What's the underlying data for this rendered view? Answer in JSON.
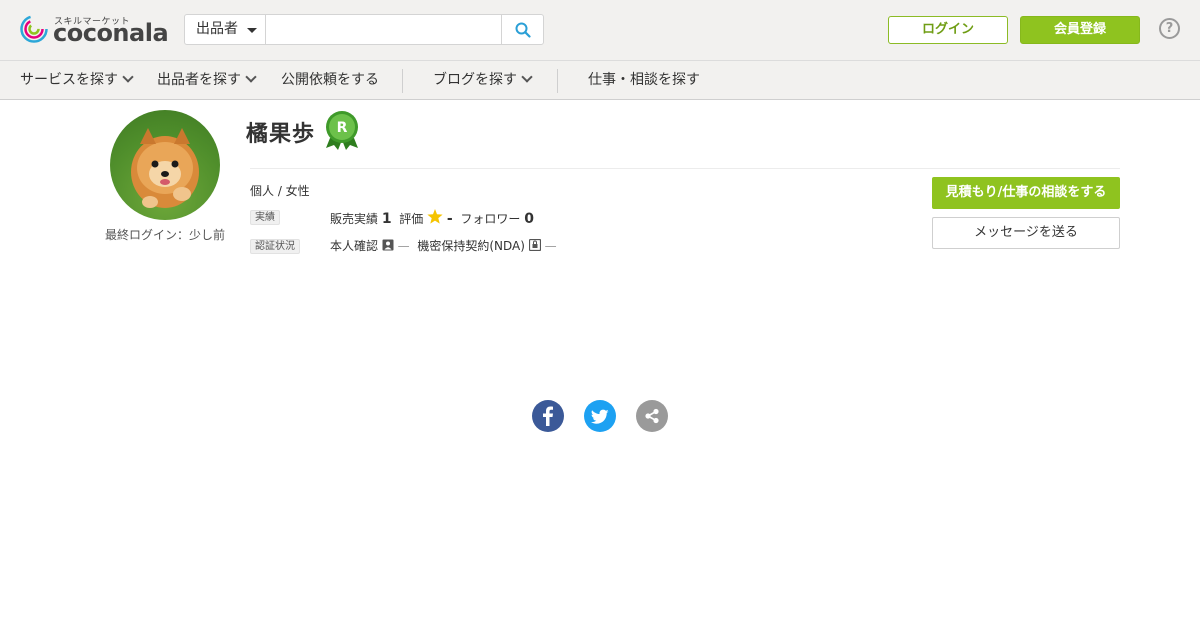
{
  "brand": {
    "sub": "スキルマーケット",
    "name": "coconala"
  },
  "search": {
    "category": "出品者",
    "placeholder": ""
  },
  "header": {
    "login": "ログイン",
    "register": "会員登録",
    "help": "?"
  },
  "nav": {
    "items": [
      {
        "label": "サービスを探す"
      },
      {
        "label": "出品者を探す"
      },
      {
        "label": "公開依頼をする"
      },
      {
        "label": "ブログを探す"
      },
      {
        "label": "仕事・相談を探す"
      }
    ]
  },
  "profile": {
    "name": "橘果歩",
    "rank": "R",
    "last_login": "最終ログイン：少し前",
    "type": "個人 / 女性",
    "performance_tag": "実績",
    "sales_label": "販売実績",
    "sales_value": "1",
    "rating_label": "評価",
    "rating_value": "-",
    "follower_label": "フォロワー",
    "follower_value": "0",
    "verification_tag": "認証状況",
    "identity_label": "本人確認",
    "identity_value": "—",
    "nda_label": "機密保持契約(NDA)",
    "nda_value": "—"
  },
  "actions": {
    "consult": "見積もり/仕事の相談をする",
    "message": "メッセージを送る"
  },
  "colors": {
    "accent": "#8fc31f",
    "header_bg": "#f2f1ef",
    "facebook": "#3b5998",
    "twitter": "#1da1f2",
    "share": "#9a9a9a",
    "star": "#f5c400"
  },
  "icons": [
    "search-icon",
    "chevron-down-icon",
    "help-icon",
    "rank-badge-icon",
    "star-icon",
    "identity-icon",
    "nda-icon",
    "facebook-icon",
    "twitter-icon",
    "share-icon"
  ]
}
